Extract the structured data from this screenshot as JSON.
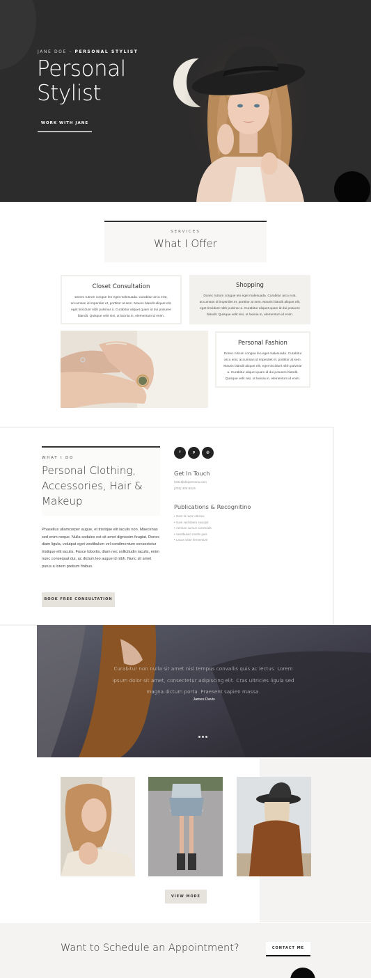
{
  "hero": {
    "eyebrow_name": "JANE DOE",
    "eyebrow_sep": " – ",
    "eyebrow_role": "PERSONAL STYLIST",
    "title": "Personal Stylist",
    "cta_label": "WORK WITH JANE"
  },
  "services": {
    "eyebrow": "SERVICES",
    "title": "What I Offer",
    "cards": [
      {
        "title": "Closet Consultation",
        "body": "Donec rutrum congue leo eget malesuada. Curabitur arcu erat, accumsan id imperdiet et, porttitor at sem. Mauris blandit aliquet elit, eget tincidunt nibh pulvinar a. Curabitur aliquet quam id dui posuere blandit. Quisque velit nisi, ut lacinia in, elementum id enim."
      },
      {
        "title": "Shopping",
        "body": "Donec rutrum congue leo eget malesuada. Curabitur arcu erat, accumsan id imperdiet et, porttitor at sem. Mauris blandit aliquet elit, eget tincidunt nibh pulvinar a. Curabitur aliquet quam id dui posuere blandit. Quisque velit nisi, ut lacinia in, elementum id enim."
      },
      {
        "title": "Personal Fashion",
        "body": "Donec rutrum congue leo eget malesuada. Curabitur arcu erat, accumsan id imperdiet et, porttitor at sem. Mauris blandit aliquet elit, eget tincidunt nibh pulvinar a. Curabitur aliquet quam id dui posuere blandit. Quisque velit nisi, ut lacinia in, elementum id enim."
      }
    ]
  },
  "about": {
    "eyebrow": "WHAT I DO",
    "title": "Personal Clothing, Accessories, Hair & Makeup",
    "body": "Phasellus ullamcorper augue, et tristique elit iaculis non. Maecenas sed enim neque. Nulla sodales est sit amet dignissim feugiat. Donec diam ligula, volutpat eget vestibulum vel condimentum consectetur tristique elit iaculis. Fusce lobortis, diam nec sollicitudin iaculis, enim nunc consequat dui, ac dictum leo augue id nibh. Nunc sit amet purus a lorem pretium finibus.",
    "button_label": "BOOK FREE CONSULTATION",
    "social": [
      {
        "icon": "facebook-icon",
        "glyph": "f"
      },
      {
        "icon": "pinterest-icon",
        "glyph": "p"
      },
      {
        "icon": "instagram-icon",
        "glyph": "◎"
      }
    ],
    "contact_heading": "Get In Touch",
    "email": "hello@divipersona.com",
    "phone": "(255) 405-6515",
    "pub_heading": "Publications & Recognitino",
    "publications": [
      "Nam id nunc ultrices",
      "Nam sed libero suscipit",
      "Aenean cursus commodo",
      "Vestibulum mattis quis",
      "Lacus vitae fermentum"
    ]
  },
  "testimonial": {
    "quote": "Curabitur non nulla sit amet nisl tempus convallis quis ac lectus. Lorem ipsum dolor sit amet, consectetur adipiscing elit. Cras ultricies ligula sed magna dictum porta. Praesent sapien massa.",
    "author": "James Davis"
  },
  "gallery": {
    "button_label": "VIEW MORE"
  },
  "cta": {
    "text": "Want to Schedule an Appointment?",
    "button_label": "CONTACT ME"
  },
  "colors": {
    "hero_bg": "#2d2c2c",
    "accent_beige": "#e6e2dc",
    "panel_bg": "#f4f3f1"
  }
}
